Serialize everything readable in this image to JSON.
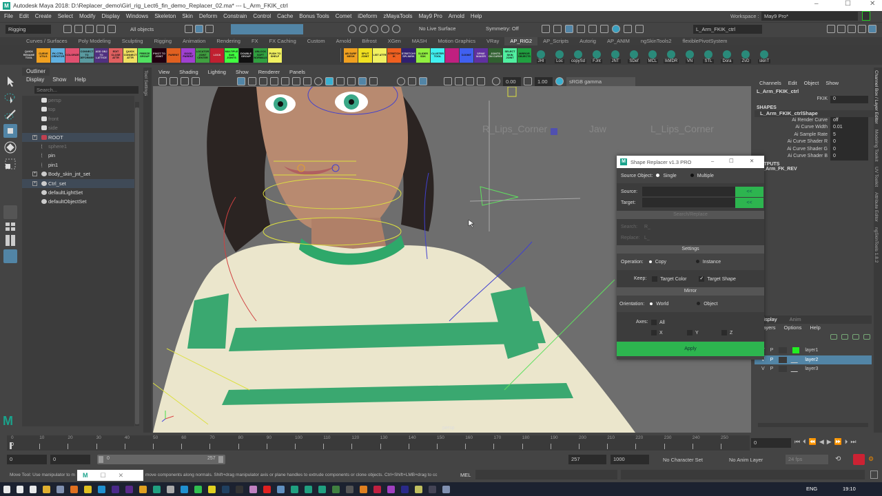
{
  "window": {
    "title": "Autodesk Maya 2018: D:\\Replacer_demo\\Girl_rig_Lect6_fin_demo_Replacer_02.ma*  ---  L_Arm_FKIK_ctrl",
    "logo": "M",
    "minimize": "–",
    "maximize": "☐",
    "close": "✕"
  },
  "menubar": [
    "File",
    "Edit",
    "Create",
    "Select",
    "Modify",
    "Display",
    "Windows",
    "Skeleton",
    "Skin",
    "Deform",
    "Constrain",
    "Control",
    "Cache",
    "Bonus Tools",
    "Comet",
    "iDeform",
    "zMayaTools",
    "May9 Pro",
    "Arnold",
    "Help"
  ],
  "statusline": {
    "menuset": "Rigging",
    "selection_mask": "All objects",
    "live_surface": "No Live Surface",
    "symmetry": "Symmetry: Off",
    "object_name": "L_Arm_FKIK_ctrl",
    "workspace_label": "Workspace :",
    "workspace": "May9 Pro*"
  },
  "shelf_tabs": [
    "Curves / Surfaces",
    "Poly Modeling",
    "Sculpting",
    "Rigging",
    "Animation",
    "Rendering",
    "FX",
    "FX Caching",
    "Custom",
    "Arnold",
    "Bifrost",
    "XGen",
    "MASH",
    "Motion Graphics",
    "VRay",
    "AP_RIG2",
    "AP_Scripts",
    "Autorig",
    "AP_ANIM",
    "ngSkinTools2",
    "flexiblePivotSystem"
  ],
  "shelf_active": "AP_RIG2",
  "shelf_buttons": [
    {
      "label": "QUICK RENAME TOOL",
      "color": "#3c3c3c"
    },
    {
      "label": "CURVE UTILS",
      "color": "#f0a020"
    },
    {
      "label": "FK CTRL CREATOR",
      "color": "#60b0e0"
    },
    {
      "label": "COLORIZE",
      "color": "#e05070"
    },
    {
      "label": "CONNECT TO DEFORMER",
      "color": "#5a9aa0"
    },
    {
      "label": "ADD OBJ TO LATTICE",
      "color": "#503080"
    },
    {
      "label": "EDIT CLOSE ATTR",
      "color": "#e06060"
    },
    {
      "label": "QUICK CONNECT ATTR",
      "color": "#f0e060"
    },
    {
      "label": "FREEZE GROUP",
      "color": "#50e060"
    },
    {
      "label": "PIVOT TO JOINT",
      "color": "#200010"
    },
    {
      "label": "PARENT",
      "color": "#e06020"
    },
    {
      "label": "GOOD PARENT",
      "color": "#a040d0"
    },
    {
      "label": "LOCATOR JOINT CENTER",
      "color": "#40a040"
    },
    {
      "label": "LOCK",
      "color": "#c02030"
    },
    {
      "label": "MULTIPLE SUB JOINTS",
      "color": "#40ff40"
    },
    {
      "label": "DOUBLE GROUP",
      "color": "#111111"
    },
    {
      "label": "UNLOCK SOFT NORMALS",
      "color": "#30a040"
    },
    {
      "label": "PUSH TO SHELF",
      "color": "#f0f060"
    },
    {
      "label": "AB SURF MESH",
      "color": "#f0a020"
    },
    {
      "label": "SPLIT JOINT",
      "color": "#f0e020"
    },
    {
      "label": "LIST ATTR",
      "color": "#f0f060"
    },
    {
      "label": "STRETCH IK",
      "color": "#f06020"
    },
    {
      "label": "STRETCHY SPLINEIK",
      "color": "#302070"
    },
    {
      "label": "SLIDER SDK",
      "color": "#90f040"
    },
    {
      "label": "CLUSTER TOOL",
      "color": "#40f0f0"
    },
    {
      "label": "",
      "color": "#c02080"
    },
    {
      "label": "DJOINT",
      "color": "#4060f0"
    },
    {
      "label": "SPINE MAKER",
      "color": "#6030a0"
    },
    {
      "label": "JOINTS ON CURVE",
      "color": "#306030"
    },
    {
      "label": "SELECT SKIN JOINT",
      "color": "#50f0a0"
    },
    {
      "label": "MIRROR OBJECTS",
      "color": "#20a040"
    }
  ],
  "shelf_icon_buttons": [
    "JHI",
    "Loc",
    "copySd",
    "FJnt",
    "JNT",
    "SDef",
    "MCL",
    "IkMDR",
    "VN",
    "STL",
    "Dora",
    "ZvD",
    "skinT"
  ],
  "outliner": {
    "title": "Outliner",
    "menu": [
      "Display",
      "Show",
      "Help"
    ],
    "search_placeholder": "Search...",
    "items": [
      {
        "label": "persp",
        "type": "camera",
        "dim": true
      },
      {
        "label": "top",
        "type": "camera",
        "dim": true
      },
      {
        "label": "front",
        "type": "camera",
        "dim": true
      },
      {
        "label": "side",
        "type": "camera",
        "dim": true
      },
      {
        "label": "ROOT",
        "type": "group",
        "expand": true,
        "selected": true
      },
      {
        "label": "sphere1",
        "type": "curve",
        "dim": true
      },
      {
        "label": "pin",
        "type": "curve"
      },
      {
        "label": "pin1",
        "type": "curve"
      },
      {
        "label": "Body_skin_jnt_set",
        "type": "set",
        "expand": true
      },
      {
        "label": "Ctrl_set",
        "type": "set",
        "expand": true,
        "selected": true
      },
      {
        "label": "defaultLightSet",
        "type": "set"
      },
      {
        "label": "defaultObjectSet",
        "type": "set"
      }
    ]
  },
  "viewport": {
    "menu": [
      "View",
      "Shading",
      "Lighting",
      "Show",
      "Renderer",
      "Panels"
    ],
    "exposure": "0.00",
    "gamma": "1.00",
    "color_space": "sRGB gamma",
    "labels": [
      "R_Lips_Corner",
      "Jaw",
      "L_Lips_Corner"
    ],
    "camera": "persp"
  },
  "side_tabs": [
    "Channel Box / Layer Editor",
    "Modeling Toolkit",
    "UV Toolkit",
    "Attribute Editor",
    "ngSkinTools 1.8.2"
  ],
  "channel_box": {
    "menu": [
      "Channels",
      "Edit",
      "Object",
      "Show"
    ],
    "object": "L_Arm_FKIK_ctrl",
    "attrs": [
      {
        "name": "FKIK",
        "value": "0"
      }
    ],
    "shapes_header": "SHAPES",
    "shape": "L_Arm_FKIK_ctrlShape",
    "shape_attrs": [
      {
        "name": "Ai Render Curve",
        "value": "off"
      },
      {
        "name": "Ai Curve Width",
        "value": "0.01"
      },
      {
        "name": "Ai Sample Rate",
        "value": "5"
      },
      {
        "name": "Ai Curve Shader R",
        "value": "0"
      },
      {
        "name": "Ai Curve Shader G",
        "value": "0"
      },
      {
        "name": "Ai Curve Shader B",
        "value": "0"
      }
    ],
    "outputs_header": "OUTPUTS",
    "output": "L_Arm_FK_REV"
  },
  "layer_editor": {
    "tabs": [
      "Display",
      "Anim"
    ],
    "menu": [
      "Layers",
      "Options",
      "Help"
    ],
    "layers": [
      {
        "v": "V",
        "p": "P",
        "name": "layer1",
        "color": "#22ee22"
      },
      {
        "v": "V",
        "p": "P",
        "name": "layer2",
        "color": "",
        "selected": true
      },
      {
        "v": "V",
        "p": "P",
        "name": "layer3",
        "color": ""
      }
    ]
  },
  "dialog": {
    "title": "Shape Replacer v1.3 PRO",
    "source_object_label": "Source Object:",
    "single": "Single",
    "multiple": "Multiple",
    "source_label": "Source:",
    "target_label": "Target:",
    "pick": "<<",
    "search_replace": "Search/Replace",
    "search_label": "Search:",
    "search_value": "R_",
    "replace_label": "Replace:",
    "replace_value": "L_",
    "settings": "Settings",
    "operation_label": "Operation:",
    "copy": "Copy",
    "instance": "Instance",
    "keep_label": "Keep:",
    "target_color": "Target Color",
    "target_shape": "Target Shape",
    "mirror": "Mirror",
    "orientation_label": "Orientation:",
    "world": "World",
    "object": "Object",
    "axes_label": "Axes:",
    "all": "All",
    "x": "X",
    "y": "Y",
    "z": "Z",
    "apply": "Apply",
    "target_shape_checked": true
  },
  "timeline": {
    "ticks": [
      "0",
      "10",
      "20",
      "30",
      "40",
      "50",
      "60",
      "70",
      "80",
      "90",
      "100",
      "110",
      "120",
      "130",
      "140",
      "150",
      "160",
      "170",
      "180",
      "190",
      "200",
      "210",
      "220",
      "230",
      "240",
      "250"
    ],
    "current_frame": "0",
    "current_field": "0"
  },
  "range": {
    "start": "0",
    "playback_start": "0",
    "slider_start": "0",
    "slider_end": "257",
    "playback_end": "257",
    "end": "1000",
    "character_set": "No Character Set",
    "anim_layer": "No Anim Layer",
    "fps": "24 fps"
  },
  "helpline": {
    "text": "Move Tool: Use manipulator to m",
    "text2": "move components along normals. Shift+drag manipulator axis or plane handles to extrude components or clone objects. Ctrl+Shift+LMB+drag to cc",
    "mel": "MEL"
  },
  "taskbar": {
    "lang": "ENG",
    "time": "19:10"
  }
}
